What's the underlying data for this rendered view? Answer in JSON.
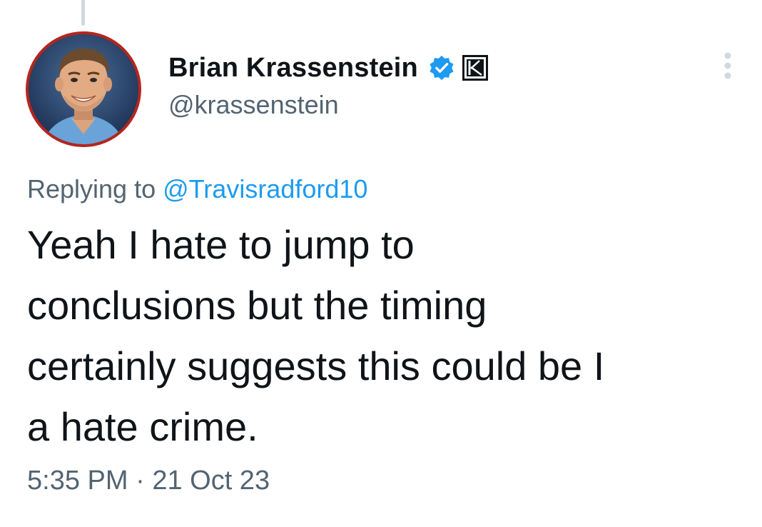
{
  "tweet": {
    "author": {
      "display_name": "Brian Krassenstein",
      "handle": "@krassenstein",
      "verified_icon": "verified-badge-icon",
      "affiliate_icon": "affiliate-logo-icon",
      "accent_color": "#1d9bf0"
    },
    "reply": {
      "prefix": "Replying to ",
      "target_handle": "@Travisradford10"
    },
    "text": "Yeah I hate to jump to\nconclusions but the timing\ncertainly suggests this could be I\na hate crime.",
    "time": "5:35 PM",
    "separator": " · ",
    "date": "21 Oct 23"
  }
}
